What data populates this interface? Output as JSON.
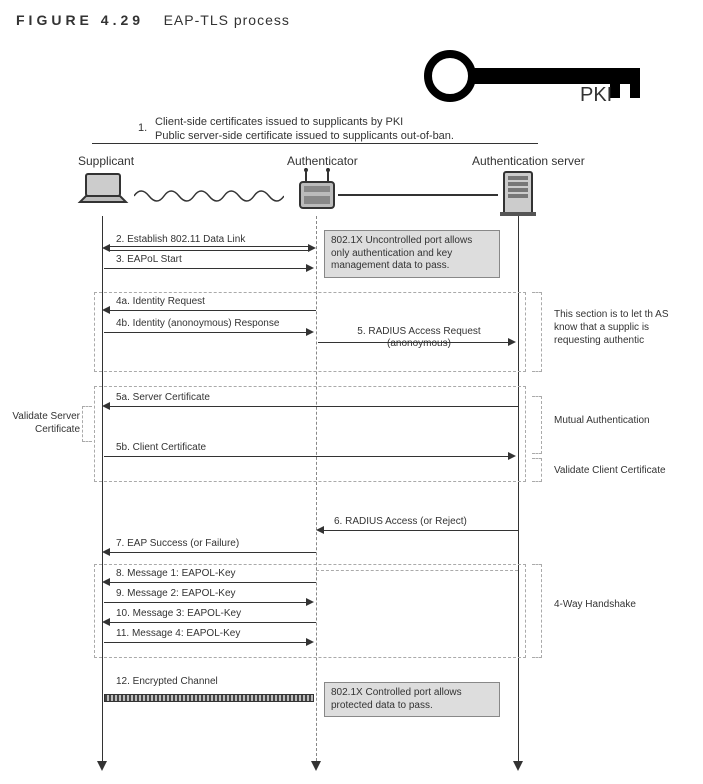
{
  "figure": {
    "number": "FIGURE 4.29",
    "title": "EAP-TLS process"
  },
  "pki_label": "PKI",
  "step1": {
    "num": "1.",
    "line1": "Client-side certificates issued to supplicants by PKI",
    "line2": "Public server-side certificate issued to supplicants out-of-ban."
  },
  "lanes": {
    "supplicant": "Supplicant",
    "authenticator": "Authenticator",
    "authserver": "Authentication server"
  },
  "messages": {
    "m2": "2. Establish 802.11 Data Link",
    "m3": "3. EAPoL Start",
    "m4a": "4a. Identity Request",
    "m4b": "4b. Identity (anonoymous) Response",
    "m5": "5. RADIUS Access Request (anonoymous)",
    "m5a": "5a. Server Certificate",
    "m5b": "5b. Client Certificate",
    "m6": "6. RADIUS Access (or Reject)",
    "m7": "7. EAP Success (or Failure)",
    "m8": "8. Message 1: EAPOL-Key",
    "m9": "9. Message 2: EAPOL-Key",
    "m10": "10. Message 3: EAPOL-Key",
    "m11": "11. Message 4: EAPOL-Key",
    "m12": "12. Encrypted Channel"
  },
  "notes": {
    "uncontrolled_port": "802.1X Uncontrolled port allows only authentication and key management data to pass.",
    "controlled_port": "802.1X Controlled port allows protected data to pass."
  },
  "side": {
    "identity_section": "This section is to let th AS know that a supplic is requesting authentic",
    "validate_server": "Validate Server Certificate",
    "mutual_auth": "Mutual Authentication",
    "validate_client": "Validate Client Certificate",
    "handshake": "4-Way Handshake"
  }
}
